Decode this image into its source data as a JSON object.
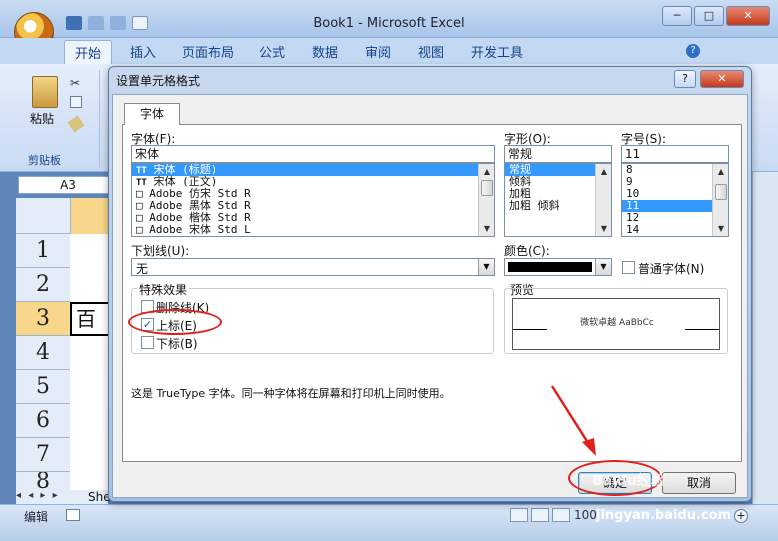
{
  "window": {
    "title": "Book1 - Microsoft Excel",
    "buttons": [
      "─",
      "□",
      "✕"
    ]
  },
  "ribbon": {
    "tabs": [
      "开始",
      "插入",
      "页面布局",
      "公式",
      "数据",
      "审阅",
      "视图",
      "开发工具"
    ],
    "active_tab": "开始",
    "paste_label": "粘贴",
    "group_label": "剪贴板"
  },
  "sheet": {
    "name_box": "A3",
    "rows": [
      "1",
      "2",
      "3",
      "4",
      "5",
      "6",
      "7",
      "8"
    ],
    "cell_a3": "百",
    "tab_fragment": "She"
  },
  "status": {
    "mode": "编辑",
    "zoom": "100"
  },
  "dialog": {
    "title": "设置单元格格式",
    "help": "?",
    "close": "✕",
    "tab": "字体",
    "font": {
      "label": "字体(F):",
      "value": "宋体",
      "items": [
        "宋体 (标题)",
        "宋体 (正文)",
        "Adobe 仿宋 Std R",
        "Adobe 黑体 Std R",
        "Adobe 楷体 Std R",
        "Adobe 宋体 Std L"
      ],
      "icons": [
        "TT",
        "TT",
        "□",
        "□",
        "□",
        "□"
      ]
    },
    "style": {
      "label": "字形(O):",
      "value": "常规",
      "items": [
        "常规",
        "倾斜",
        "加粗",
        "加粗 倾斜"
      ]
    },
    "size": {
      "label": "字号(S):",
      "value": "11",
      "items": [
        "8",
        "9",
        "10",
        "11",
        "12",
        "14"
      ]
    },
    "underline": {
      "label": "下划线(U):",
      "value": "无"
    },
    "color": {
      "label": "颜色(C):",
      "swatch": "#000000",
      "normal_font_label": "普通字体(N)"
    },
    "effects": {
      "label": "特殊效果",
      "strikethrough": "删除线(K)",
      "superscript": "上标(E)",
      "subscript": "下标(B)",
      "superscript_checked": true
    },
    "preview": {
      "label": "预览",
      "text": "微软卓越 AaBbCc"
    },
    "info": "这是 TrueType 字体。同一种字体将在屏幕和打印机上同时使用。",
    "ok": "确定",
    "cancel": "取消"
  },
  "watermark": {
    "logo": "Baidu经验",
    "url": "jingyan.baidu.com"
  },
  "annotation_color": "#e0201a"
}
